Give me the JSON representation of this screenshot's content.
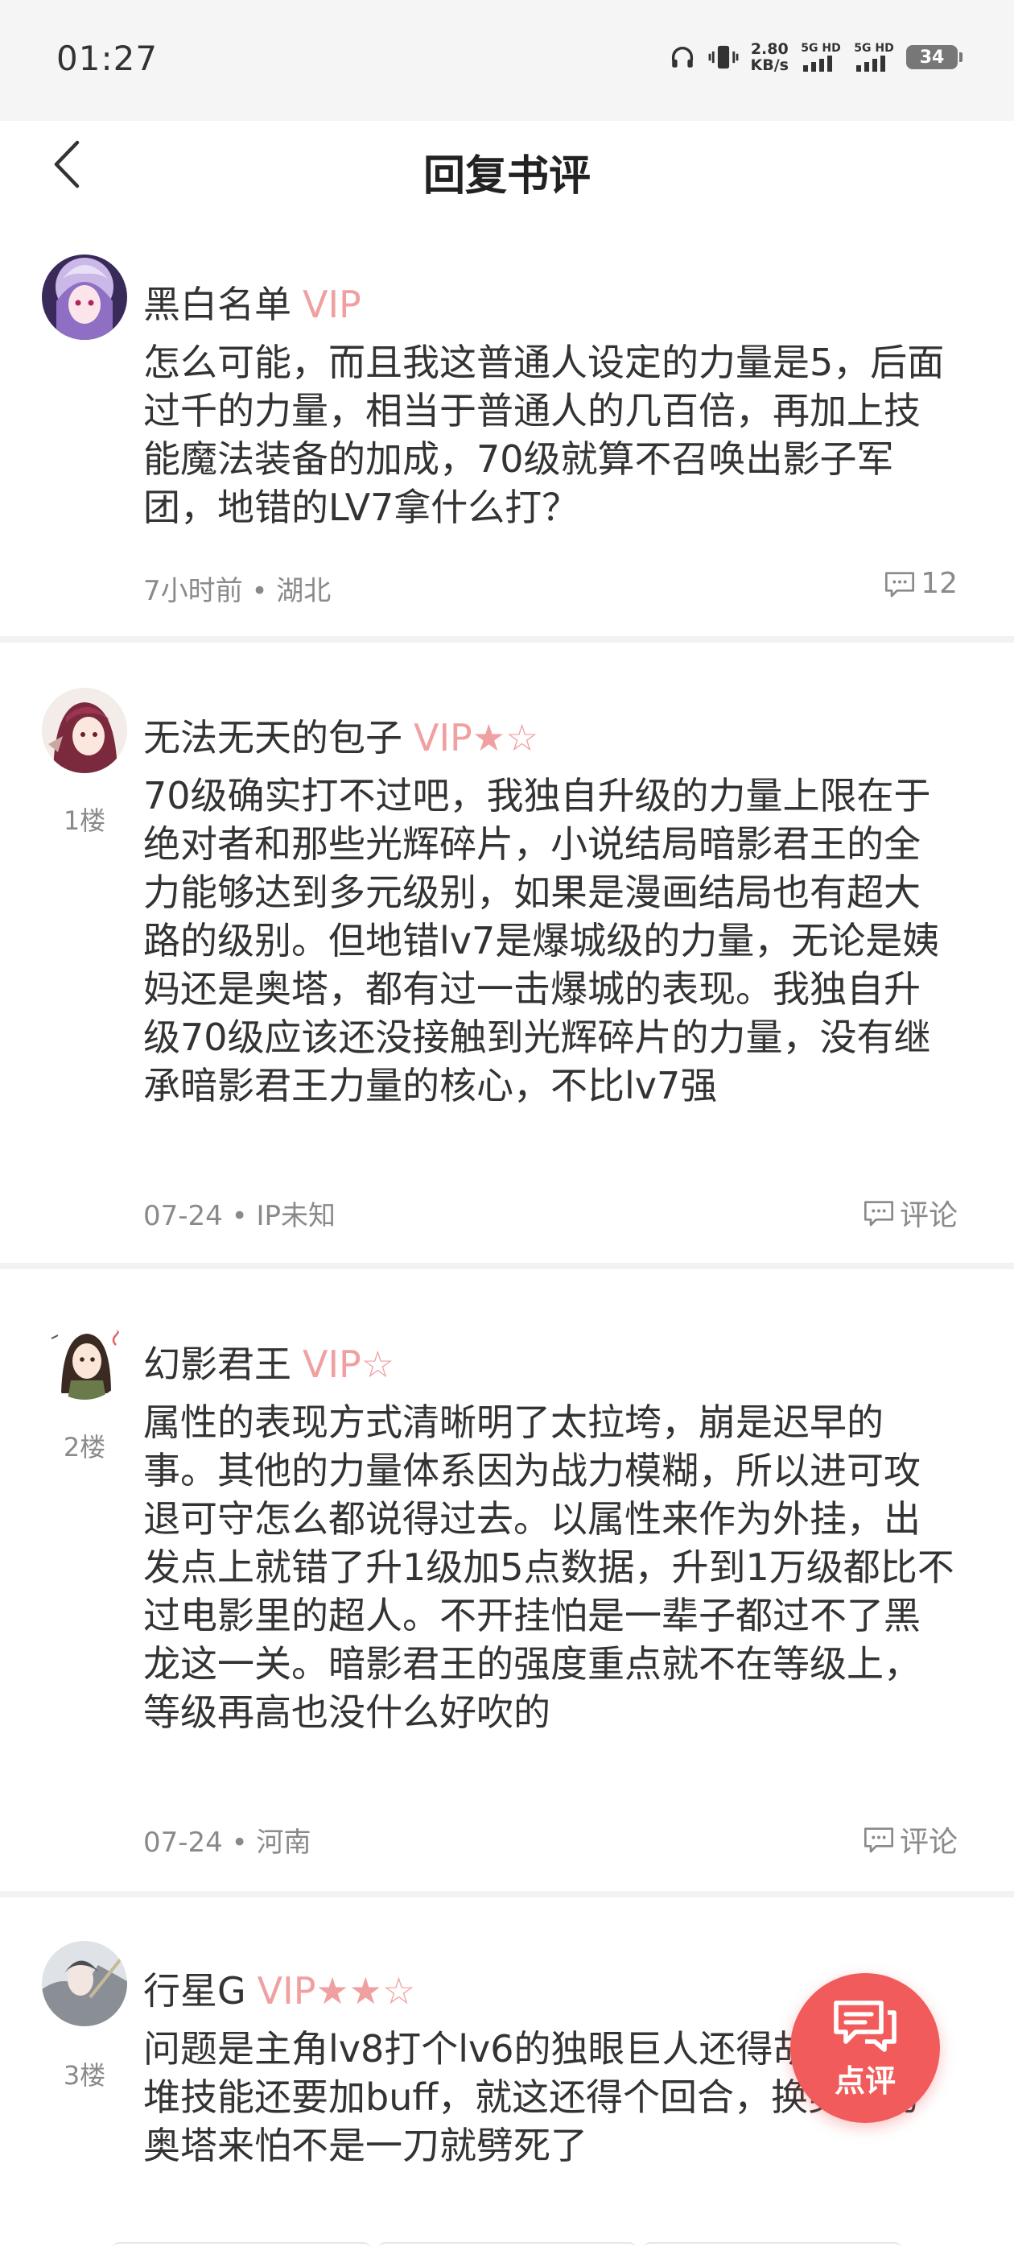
{
  "status": {
    "time": "01:27",
    "net_speed_value": "2.80",
    "net_speed_unit": "KB/s",
    "sim1": "5G HD",
    "sim2": "5G HD",
    "battery": "34"
  },
  "header": {
    "title": "回复书评"
  },
  "comments": [
    {
      "user": "黑白名单",
      "badge": "VIP",
      "floor": "",
      "text": "怎么可能，而且我这普通人设定的力量是5，后面过千的力量，相当于普通人的几百倍，再加上技能魔法装备的加成，70级就算不召唤出影子军团，地错的LV7拿什么打？",
      "meta": "7小时前 • 湖北",
      "action": "12"
    },
    {
      "user": "无法无天的包子",
      "badge": "VIP★☆",
      "floor": "1楼",
      "text": "70级确实打不过吧，我独自升级的力量上限在于绝对者和那些光辉碎片，小说结局暗影君王的全力能够达到多元级别，如果是漫画结局也有超大路的级别。但地错lv7是爆城级的力量，无论是姨妈还是奥塔，都有过一击爆城的表现。我独自升级70级应该还没接触到光辉碎片的力量，没有继承暗影君王力量的核心，不比lv7强",
      "meta": "07-24 • IP未知",
      "action": "评论"
    },
    {
      "user": "幻影君王",
      "badge": "VIP☆",
      "floor": "2楼",
      "text": "属性的表现方式清晰明了太拉垮，崩是迟早的事。其他的力量体系因为战力模糊，所以进可攻退可守怎么都说得过去。以属性来作为外挂，出发点上就错了升1级加5点数据，升到1万级都比不过电影里的超人。不开挂怕是一辈子都过不了黑龙这一关。暗影君王的强度重点就不在等级上，等级再高也没什么好吹的",
      "meta": "07-24 • 河南",
      "action": "评论"
    },
    {
      "user": "行星G",
      "badge": "VIP★★☆",
      "floor": "3楼",
      "text": "问题是主角lv8打个lv6的独眼巨人还得胡哨放一堆技能还要加buff，就这还得个回合，换美神的奥塔来怕不是一刀就劈死了",
      "meta": "",
      "action": ""
    }
  ],
  "fab": {
    "label": "点评"
  },
  "colors": {
    "accent": "#f15b5b",
    "vip": "#f0a0a0",
    "meta": "#8a8a8a"
  }
}
